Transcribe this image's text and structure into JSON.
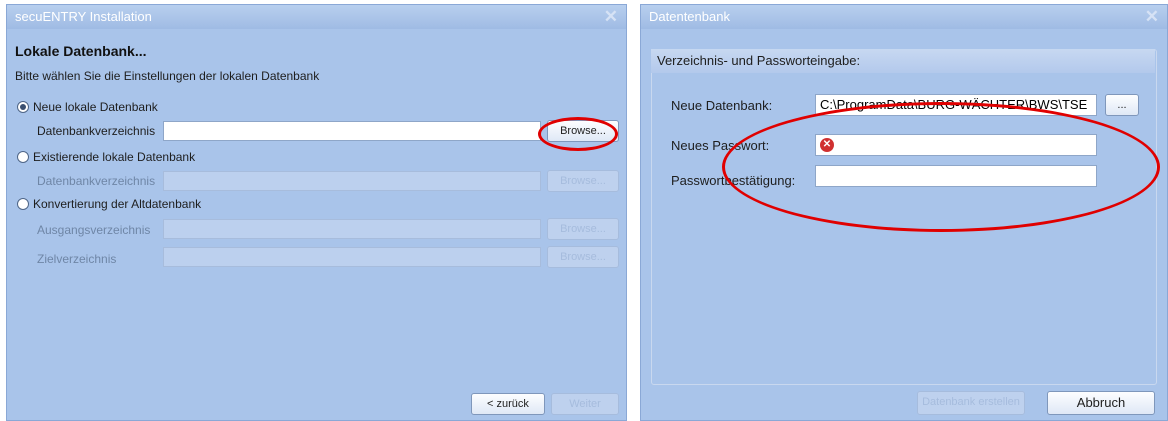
{
  "window1": {
    "title": "secuENTRY Installation",
    "heading": "Lokale Datenbank...",
    "subtitle": "Bitte wählen Sie die Einstellungen der lokalen Datenbank",
    "radio_new": "Neue lokale Datenbank",
    "label_dir1": "Datenbankverzeichnis",
    "browse": "Browse...",
    "radio_existing": "Existierende lokale Datenbank",
    "label_dir2": "Datenbankverzeichnis",
    "browse_disabled": "Browse...",
    "radio_convert": "Konvertierung der Altdatenbank",
    "label_source": "Ausgangsverzeichnis",
    "label_target": "Zielverzeichnis",
    "back": "< zurück",
    "next": "Weiter"
  },
  "window2": {
    "title": "Datentenbank",
    "group_title": "Verzeichnis- und Passworteingabe:",
    "label_db": "Neue Datenbank:",
    "db_path": "C:\\ProgramData\\BURG-WÄCHTER\\BWS\\TSE",
    "dots": "...",
    "label_pw": "Neues Passwort:",
    "label_confirm": "Passwortbestätigung:",
    "create": "Datenbank erstellen",
    "cancel": "Abbruch"
  },
  "colors": {
    "annotation": "#e00000",
    "error_icon": "#d03030"
  }
}
